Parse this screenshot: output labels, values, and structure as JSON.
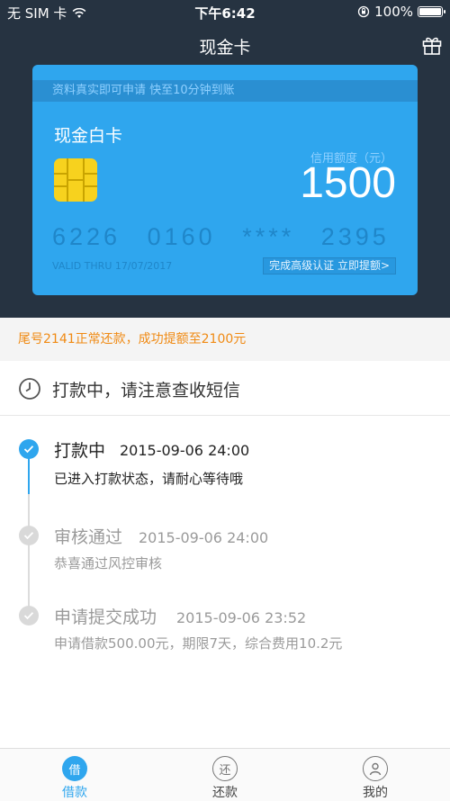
{
  "status_bar": {
    "carrier": "无 SIM 卡",
    "time": "下午6:42",
    "battery": "100%",
    "battery_level": 1.0
  },
  "nav": {
    "title": "现金卡",
    "right_icon": "gift-icon"
  },
  "card": {
    "banner": "资料真实即可申请 快至10分钟到账",
    "name": "现金白卡",
    "limit_label": "信用额度（元）",
    "limit": "1500",
    "number_groups": [
      "6226",
      "0160",
      "****",
      "2395"
    ],
    "valid_thru": "VALID THRU 17/07/2017",
    "cta": "完成高级认证 立即提额>",
    "color": "#2fa6ee"
  },
  "notice": "尾号2141正常还款，成功提额至2100元",
  "status": {
    "icon": "clock-icon",
    "text": "打款中，请注意查收短信"
  },
  "timeline": [
    {
      "title": "打款中",
      "time": "2015-09-06   24:00",
      "sub": "已进入打款状态，请耐心等待哦",
      "active": true
    },
    {
      "title": "审核通过",
      "time": "2015-09-06   24:00",
      "sub": "恭喜通过风控审核",
      "active": false
    },
    {
      "title": "申请提交成功",
      "time": "2015-09-06   23:52",
      "sub": "申请借款500.00元，期限7天，综合费用10.2元",
      "active": false
    }
  ],
  "tabs": [
    {
      "icon_text": "借",
      "label": "借款",
      "active": true
    },
    {
      "icon_text": "还",
      "label": "还款",
      "active": false
    },
    {
      "icon_text": "",
      "label": "我的",
      "active": false
    }
  ],
  "colors": {
    "header_bg": "#263341",
    "accent": "#2fa6ee",
    "notice": "#f08a13",
    "inactive": "#9a9a9a"
  }
}
